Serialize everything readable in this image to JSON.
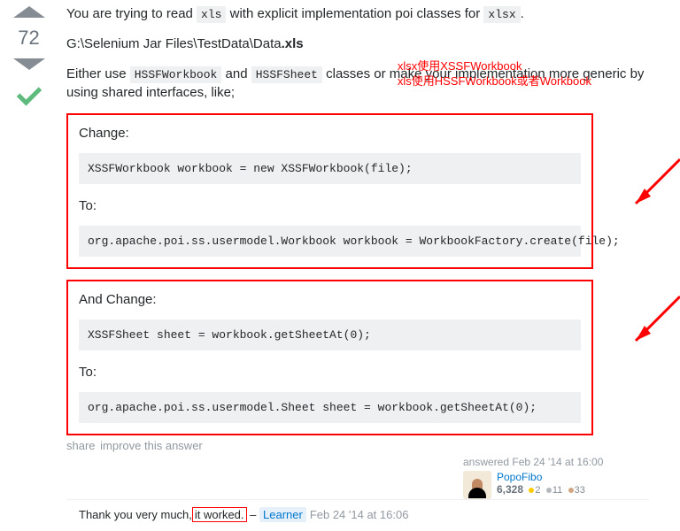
{
  "vote": {
    "score": "72"
  },
  "answer": {
    "intro_pre": "You are trying to read ",
    "intro_code1": "xls",
    "intro_mid": " with explicit implementation poi classes for ",
    "intro_code2": "xlsx",
    "intro_post": ".",
    "path_pre": "G:\\Selenium Jar Files\\TestData\\Data",
    "path_bold": ".xls",
    "either_pre": "Either use ",
    "hssf_wb": "HSSFWorkbook",
    "either_and": " and ",
    "hssf_sheet": "HSSFSheet",
    "either_post": " classes or make your implementation more generic by using shared interfaces, like;",
    "red_note_l1": "xlsx使用XSSFWorkbook",
    "red_note_l2": "xls使用HSSFWorkbook或者Workbook",
    "box1": {
      "h1": "Change:",
      "code1": "XSSFWorkbook workbook = new XSSFWorkbook(file);",
      "h2": "To:",
      "code2": "org.apache.poi.ss.usermodel.Workbook workbook = WorkbookFactory.create(file);"
    },
    "box2": {
      "h1": "And Change:",
      "code1": "XSSFSheet sheet = workbook.getSheetAt(0);",
      "h2": "To:",
      "code2": "org.apache.poi.ss.usermodel.Sheet sheet = workbook.getSheetAt(0);"
    }
  },
  "actions": {
    "share": "share",
    "improve": "improve this answer"
  },
  "signature": {
    "when": "answered Feb 24 '14 at 16:00",
    "name": "PopoFibo",
    "rep": "6,328",
    "gold": "2",
    "silver": "11",
    "bronze": "33"
  },
  "comment": {
    "pre": "Thank you very much,",
    "boxed": " it worked.",
    "dash": " – ",
    "user": "Learner",
    "ts": "Feb 24 '14 at 16:06"
  }
}
